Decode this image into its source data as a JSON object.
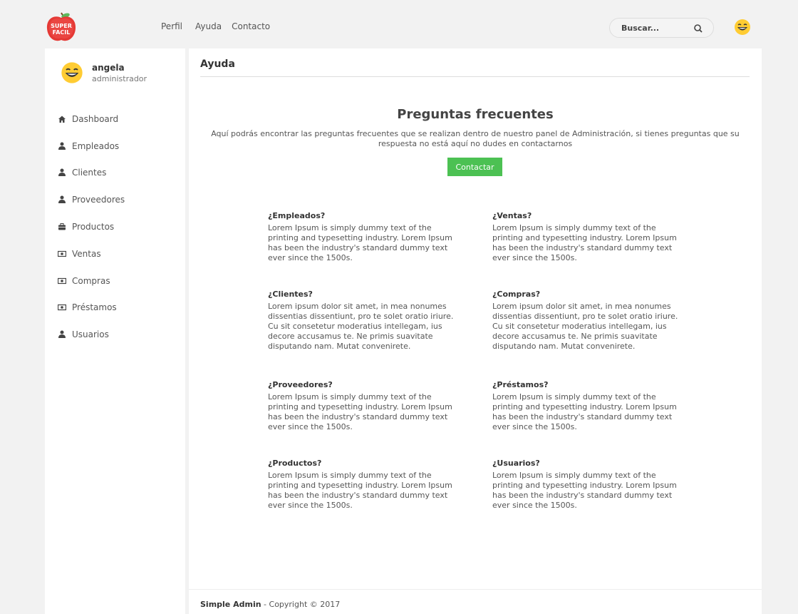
{
  "header": {
    "logo_text_top": "SUPER",
    "logo_text_bottom": "FACIL",
    "nav": [
      "Perfil",
      "Ayuda",
      "Contacto"
    ],
    "search_placeholder": "Buscar..."
  },
  "sidebar": {
    "user_name": "angela",
    "user_role": "administrador",
    "items": [
      {
        "label": "Dashboard",
        "icon": "home-icon"
      },
      {
        "label": "Empleados",
        "icon": "user-icon"
      },
      {
        "label": "Clientes",
        "icon": "user-icon"
      },
      {
        "label": "Proveedores",
        "icon": "user-icon"
      },
      {
        "label": "Productos",
        "icon": "briefcase-icon"
      },
      {
        "label": "Ventas",
        "icon": "money-icon"
      },
      {
        "label": "Compras",
        "icon": "money-icon"
      },
      {
        "label": "Préstamos",
        "icon": "money-icon"
      },
      {
        "label": "Usuarios",
        "icon": "user-icon"
      }
    ]
  },
  "main": {
    "page_title": "Ayuda",
    "faq_title": "Preguntas frecuentes",
    "faq_intro": "Aquí podrás encontrar las preguntas frecuentes que se realizan dentro de nuestro panel de Administración, si tienes preguntas que su respuesta no está aquí no dudes en contactarnos",
    "contact_button": "Contactar",
    "faqs": [
      {
        "q": "¿Empleados?",
        "a": "Lorem Ipsum is simply dummy text of the printing and typesetting industry. Lorem Ipsum has been the industry's standard dummy text ever since the 1500s."
      },
      {
        "q": "¿Ventas?",
        "a": "Lorem Ipsum is simply dummy text of the printing and typesetting industry. Lorem Ipsum has been the industry's standard dummy text ever since the 1500s."
      },
      {
        "q": "¿Clientes?",
        "a": "Lorem ipsum dolor sit amet, in mea nonumes dissentias dissentiunt, pro te solet oratio iriure. Cu sit consetetur moderatius intellegam, ius decore accusamus te. Ne primis suavitate disputando nam. Mutat convenirete."
      },
      {
        "q": "¿Compras?",
        "a": "Lorem ipsum dolor sit amet, in mea nonumes dissentias dissentiunt, pro te solet oratio iriure. Cu sit consetetur moderatius intellegam, ius decore accusamus te. Ne primis suavitate disputando nam. Mutat convenirete."
      },
      {
        "q": "¿Proveedores?",
        "a": "Lorem Ipsum is simply dummy text of the printing and typesetting industry. Lorem Ipsum has been the industry's standard dummy text ever since the 1500s."
      },
      {
        "q": "¿Préstamos?",
        "a": "Lorem Ipsum is simply dummy text of the printing and typesetting industry. Lorem Ipsum has been the industry's standard dummy text ever since the 1500s."
      },
      {
        "q": "¿Productos?",
        "a": "Lorem Ipsum is simply dummy text of the printing and typesetting industry. Lorem Ipsum has been the industry's standard dummy text ever since the 1500s."
      },
      {
        "q": "¿Usuarios?",
        "a": "Lorem Ipsum is simply dummy text of the printing and typesetting industry. Lorem Ipsum has been the industry's standard dummy text ever since the 1500s."
      }
    ]
  },
  "footer": {
    "brand": "Simple Admin",
    "copyright": " - Copyright © 2017"
  },
  "colors": {
    "accent_green": "#4cc153",
    "background": "#f2f2f2",
    "panel": "#ffffff"
  }
}
